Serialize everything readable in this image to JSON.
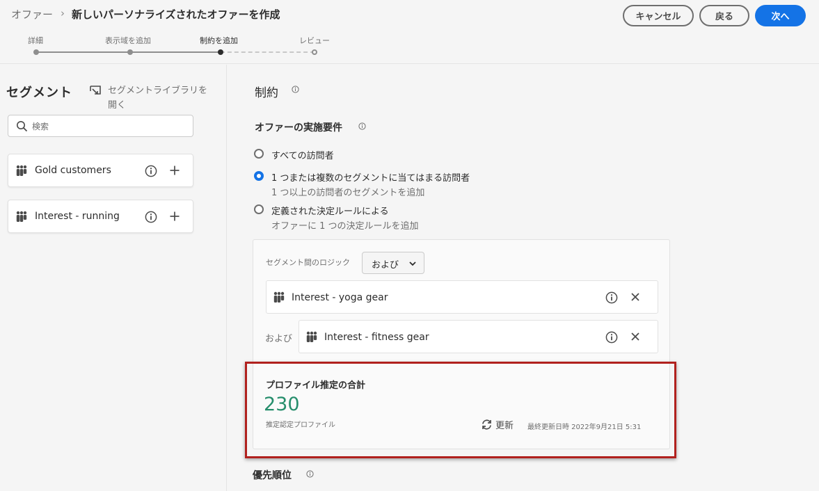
{
  "header": {
    "breadcrumb_parent": "オファー",
    "breadcrumb_separator": "›",
    "title": "新しいパーソナライズされたオファーを作成",
    "cancel_label": "キャンセル",
    "back_label": "戻る",
    "next_label": "次へ",
    "steps": [
      {
        "label": "詳細",
        "state": "done"
      },
      {
        "label": "表示域を追加",
        "state": "done"
      },
      {
        "label": "制約を追加",
        "state": "current"
      },
      {
        "label": "レビュー",
        "state": "todo"
      }
    ]
  },
  "left_panel": {
    "title": "セグメント",
    "library_link": "セグメントライブラリを開く",
    "search_placeholder": "検索",
    "segments": [
      {
        "name": "Gold customers"
      },
      {
        "name": "Interest - running"
      }
    ]
  },
  "main": {
    "constraints_heading": "制約",
    "eligibility_heading": "オファーの実施要件",
    "options": [
      {
        "label": "すべての訪問者",
        "sub": "",
        "checked": false
      },
      {
        "label": "1 つまたは複数のセグメントに当てはまる訪問者",
        "sub": "1 つ以上の訪問者のセグメントを追加",
        "checked": true
      },
      {
        "label": "定義された決定ルールによる",
        "sub": "オファーに 1 つの決定ルールを追加",
        "checked": false
      }
    ],
    "logic_label": "セグメント間のロジック",
    "logic_value": "および",
    "selected_segments": [
      {
        "name": "Interest - yoga gear"
      },
      {
        "name": "Interest - fitness gear"
      }
    ],
    "and_label": "および",
    "estimate": {
      "title": "プロファイル推定の合計",
      "value": "230",
      "subtitle": "推定認定プロファイル",
      "refresh_label": "更新",
      "last_updated": "最終更新日時 2022年9月21日 5:31"
    },
    "priority_heading": "優先順位"
  },
  "colors": {
    "accent": "#1473e6",
    "estimate_value": "#268e6c",
    "highlight_border": "#b1211e"
  }
}
